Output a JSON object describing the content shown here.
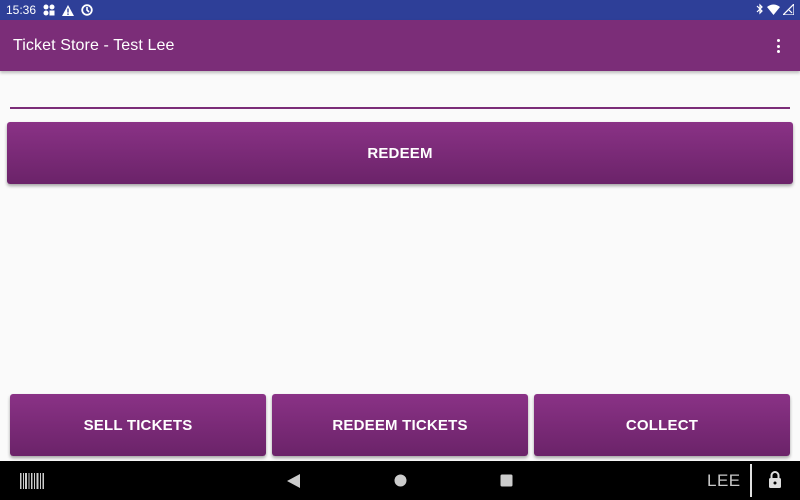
{
  "status_bar": {
    "time": "15:36",
    "icons": [
      "apps-icon",
      "warning-icon",
      "sync-icon",
      "bluetooth-icon",
      "wifi-icon",
      "signal-icon"
    ]
  },
  "app_bar": {
    "title": "Ticket Store - Test Lee",
    "menu_icon": "more-vert-icon"
  },
  "input": {
    "value": "",
    "placeholder": ""
  },
  "buttons": {
    "redeem": "REDEEM",
    "sell_tickets": "SELL TICKETS",
    "redeem_tickets": "REDEEM TICKETS",
    "collect": "COLLECT"
  },
  "nav_bar": {
    "user": "LEE",
    "icons": [
      "barcode-icon",
      "back-icon",
      "home-icon",
      "recents-icon",
      "lock-icon"
    ]
  },
  "colors": {
    "status_bar": "#2e3f98",
    "primary": "#7b2d78",
    "background": "#fafafa",
    "nav_bar": "#000000"
  }
}
